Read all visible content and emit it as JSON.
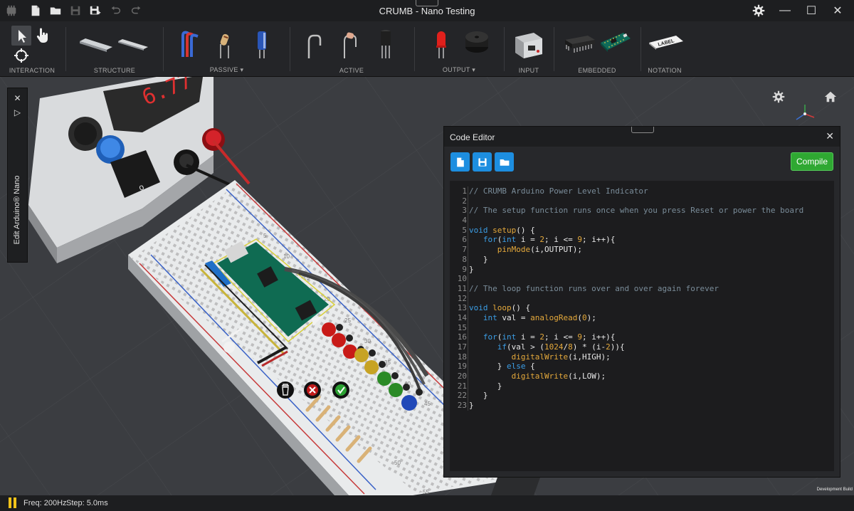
{
  "window": {
    "title": "CRUMB - Nano Testing",
    "minimize": "—",
    "maximize": "☐",
    "close": "✕"
  },
  "toolbar": {
    "groups": [
      {
        "label": "INTERACTION"
      },
      {
        "label": "STRUCTURE"
      },
      {
        "label": "PASSIVE ▾"
      },
      {
        "label": "ACTIVE"
      },
      {
        "label": "OUTPUT ▾"
      },
      {
        "label": "INPUT"
      },
      {
        "label": "EMBEDDED"
      },
      {
        "label": "NOTATION"
      }
    ],
    "label_component_text": "LABEL"
  },
  "side_panel": {
    "title": "Edit Arduino® Nano",
    "close": "✕",
    "expand": "▷"
  },
  "scene": {
    "psu_display": "6.77",
    "breadboard_numbers": [
      "5",
      "10",
      "15",
      "20",
      "25",
      "30",
      "35",
      "40",
      "45",
      "50",
      "55"
    ],
    "actions": {
      "delete": "delete",
      "cancel": "cancel",
      "confirm": "confirm"
    }
  },
  "editor": {
    "title": "Code Editor",
    "close": "✕",
    "compile_label": "Compile",
    "lines": [
      "// CRUMB Arduino Power Level Indicator",
      "",
      "// The setup function runs once when you press Reset or power the board",
      "",
      "void setup() {",
      "   for(int i = 2; i <= 9; i++){",
      "      pinMode(i,OUTPUT);",
      "   }",
      "}",
      "",
      "// The loop function runs over and over again forever",
      "",
      "void loop() {",
      "   int val = analogRead(0);",
      "",
      "   for(int i = 2; i <= 9; i++){",
      "      if(val > (1024/8) * (i-2)){",
      "         digitalWrite(i,HIGH);",
      "      } else {",
      "         digitalWrite(i,LOW);",
      "      }",
      "   }",
      "}"
    ]
  },
  "status": {
    "freq": "Freq: 200Hz",
    "step": "Step: 5.0ms",
    "build": "Development Build"
  },
  "colors": {
    "accent_blue": "#1d8ee0",
    "compile_green": "#2fa832",
    "pause_yellow": "#f2c319"
  }
}
